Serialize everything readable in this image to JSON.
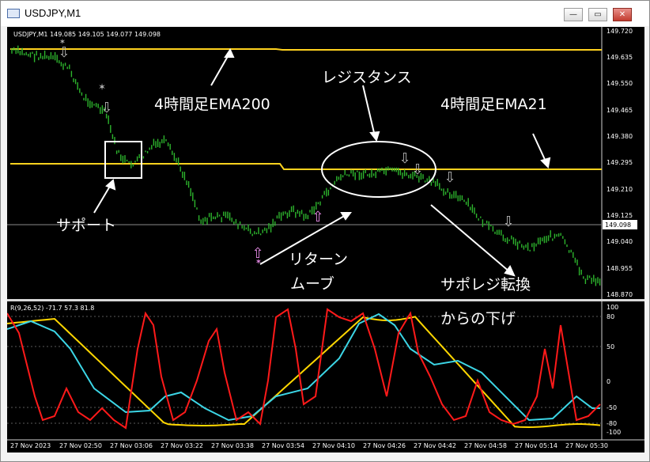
{
  "window": {
    "title": "USDJPY,M1",
    "buttons": {
      "minimize": "—",
      "restore": "▭",
      "close": "✕"
    }
  },
  "main_chart": {
    "header": "USDJPY,M1  149.085 149.105 149.077 149.098",
    "price_axis": [
      "149.720",
      "149.635",
      "149.550",
      "149.465",
      "149.380",
      "149.295",
      "149.210",
      "149.125",
      "149.040",
      "148.955",
      "148.870"
    ],
    "current_price": "149.098",
    "ema200_4h_label": "4時間足EMA200",
    "ema21_4h_label": "4時間足EMA21",
    "resistance_label": "レジスタンス",
    "support_label": "サポート",
    "return_move_label_1": "リターン",
    "return_move_label_2": "ムーブ",
    "sapo_reji_label_1": "サポレジ転換",
    "sapo_reji_label_2": "からの下げ"
  },
  "oscillator": {
    "header": "R(9,26,52) -71.7 57.3 81.8",
    "levels": [
      "100",
      "80",
      "50",
      "0",
      "-50",
      "-80",
      "-100"
    ]
  },
  "time_axis": [
    "27 Nov 2023",
    "27 Nov 02:50",
    "27 Nov 03:06",
    "27 Nov 03:22",
    "27 Nov 03:38",
    "27 Nov 03:54",
    "27 Nov 04:10",
    "27 Nov 04:26",
    "27 Nov 04:42",
    "27 Nov 04:58",
    "27 Nov 05:14",
    "27 Nov 05:30"
  ],
  "colors": {
    "background": "#000000",
    "candle": "#2db52d",
    "ema": "#ffd21e",
    "osc_red": "#ff1a1a",
    "osc_cyan": "#3cd6e6",
    "osc_yellow": "#ffd700",
    "annotation": "#ffffff",
    "up_arrow": "#e68ae6",
    "down_arrow": "#b4b4b4"
  }
}
